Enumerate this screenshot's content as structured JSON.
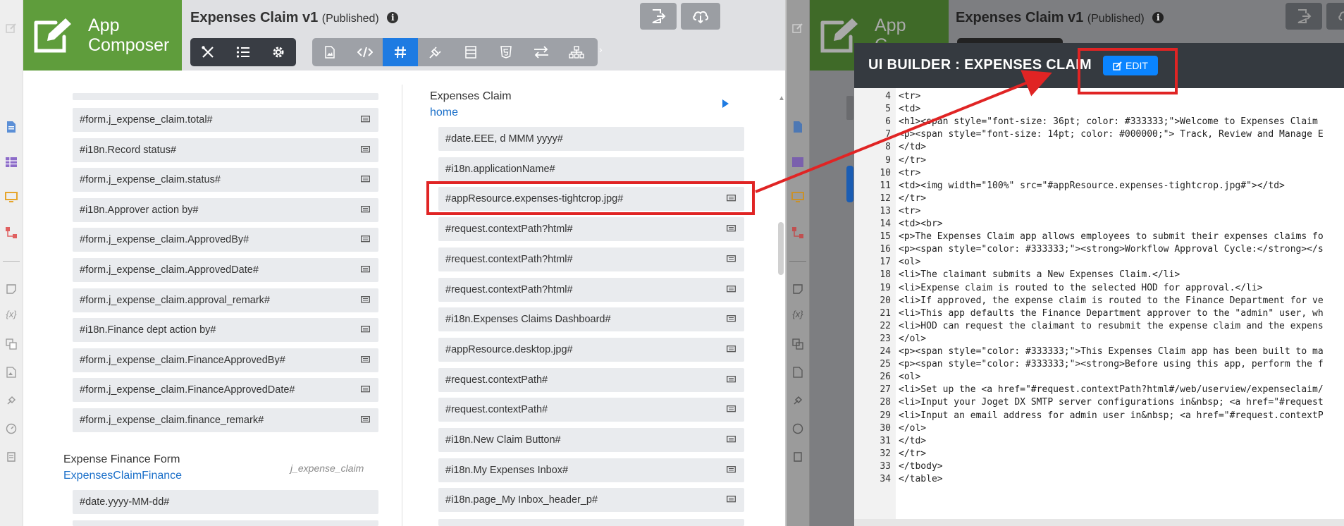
{
  "left": {
    "logo_line1": "App",
    "logo_line2": "Composer",
    "title": "Expenses Claim v1",
    "status": "(Published)",
    "info": "i",
    "left_list": [
      "#form.j_expense_claim.total#",
      "#i18n.Record status#",
      "#form.j_expense_claim.status#",
      "#i18n.Approver action by#",
      "#form.j_expense_claim.ApprovedBy#",
      "#form.j_expense_claim.ApprovedDate#",
      "#form.j_expense_claim.approval_remark#",
      "#i18n.Finance dept action by#",
      "#form.j_expense_claim.FinanceApprovedBy#",
      "#form.j_expense_claim.FinanceApprovedDate#",
      "#form.j_expense_claim.finance_remark#"
    ],
    "finance_section": {
      "title": "Expense Finance Form",
      "link": "ExpensesClaimFinance",
      "table": "j_expense_claim",
      "first_item": "#date.yyyy-MM-dd#"
    },
    "right_section": {
      "title": "Expenses Claim",
      "link": "home"
    },
    "right_list": [
      "#date.EEE, d MMM yyyy#",
      "#i18n.applicationName#",
      "#appResource.expenses-tightcrop.jpg#",
      "#request.contextPath?html#",
      "#request.contextPath?html#",
      "#request.contextPath?html#",
      "#i18n.Expenses Claims Dashboard#",
      "#appResource.desktop.jpg#",
      "#request.contextPath#",
      "#request.contextPath#",
      "#i18n.New Claim Button#",
      "#i18n.My Expenses Inbox#",
      "#i18n.page_My Inbox_header_p#"
    ]
  },
  "right": {
    "logo_line1": "App",
    "logo_line2": "C",
    "title": "Expenses Claim v1",
    "status": "(Published)",
    "info": "i",
    "ui_builder_title": "UI BUILDER : EXPENSES CLAIM",
    "edit_label": "EDIT",
    "code_lines": [
      {
        "n": "4",
        "t": "<tr>"
      },
      {
        "n": "5",
        "t": "<td>"
      },
      {
        "n": "6",
        "t": "<h1><span style=\"font-size: 36pt; color: #333333;\">Welcome to Expenses Claim"
      },
      {
        "n": "7",
        "t": "<p><span style=\"font-size: 14pt; color: #000000;\"> Track, Review and Manage E"
      },
      {
        "n": "8",
        "t": "</td>"
      },
      {
        "n": "9",
        "t": "</tr>"
      },
      {
        "n": "10",
        "t": "<tr>"
      },
      {
        "n": "11",
        "t": "<td><img width=\"100%\" src=\"#appResource.expenses-tightcrop.jpg#\"></td>"
      },
      {
        "n": "12",
        "t": "</tr>"
      },
      {
        "n": "13",
        "t": "<tr>"
      },
      {
        "n": "14",
        "t": "<td><br>"
      },
      {
        "n": "15",
        "t": "<p>The Expenses Claim app allows employees to submit their expenses claims fo"
      },
      {
        "n": "16",
        "t": "<p><span style=\"color: #333333;\"><strong>Workflow Approval Cycle:</strong></s"
      },
      {
        "n": "17",
        "t": "<ol>"
      },
      {
        "n": "18",
        "t": "<li>The claimant submits a New Expenses Claim.</li>"
      },
      {
        "n": "19",
        "t": "<li>Expense claim is routed to the selected HOD for approval.</li>"
      },
      {
        "n": "20",
        "t": "<li>If approved, the expense claim is routed to the Finance Department for ve"
      },
      {
        "n": "21",
        "t": "<li>This app defaults the Finance Department approver to the \"admin\" user, wh"
      },
      {
        "n": "22",
        "t": "<li>HOD can request the claimant to resubmit the expense claim and the expens"
      },
      {
        "n": "23",
        "t": "</ol>"
      },
      {
        "n": "24",
        "t": "<p><span style=\"color: #333333;\">This Expenses Claim app has been built to ma"
      },
      {
        "n": "25",
        "t": "<p><span style=\"color: #333333;\"><strong>Before using this app, perform the f"
      },
      {
        "n": "26",
        "t": "<ol>"
      },
      {
        "n": "27",
        "t": "<li>Set up the <a href=\"#request.contextPath?html#/web/userview/expenseclaim/"
      },
      {
        "n": "28",
        "t": "<li>Input your Joget DX SMTP server configurations in&nbsp; <a href=\"#request"
      },
      {
        "n": "29",
        "t": "<li>Input an email address for admin user in&nbsp; <a href=\"#request.contextP"
      },
      {
        "n": "30",
        "t": "</ol>"
      },
      {
        "n": "31",
        "t": "</td>"
      },
      {
        "n": "32",
        "t": "</tr>"
      },
      {
        "n": "33",
        "t": "</tbody>"
      },
      {
        "n": "34",
        "t": "</table>"
      }
    ]
  },
  "colors": {
    "logo_green": "#5f9d3c",
    "accent_blue": "#1e7be2",
    "highlight_red": "#e02424",
    "toolbar_dark": "#393d44"
  }
}
